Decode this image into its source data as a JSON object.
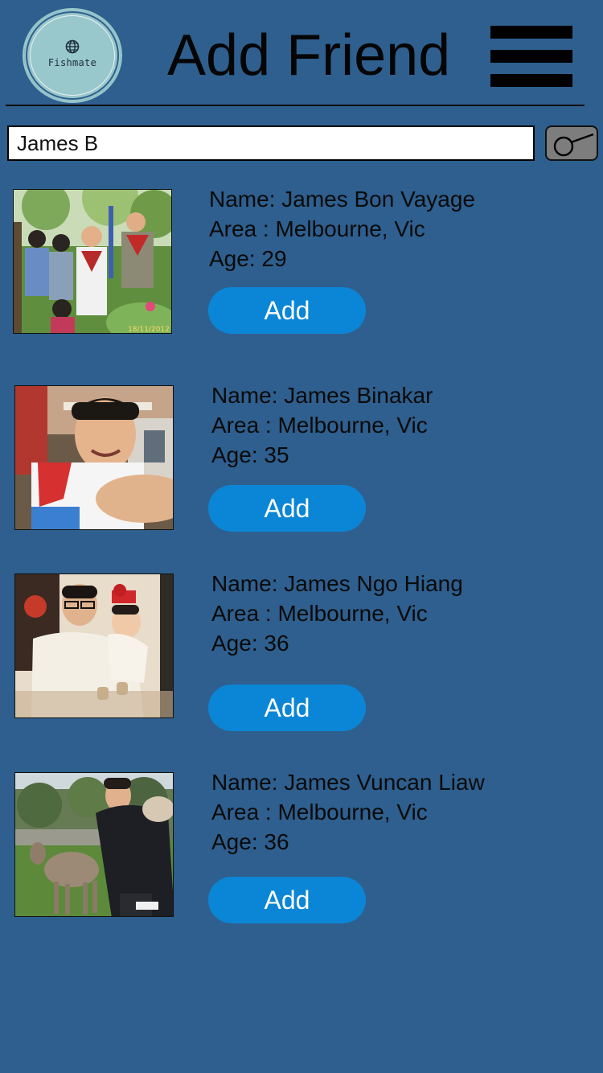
{
  "header": {
    "logo_text": "Fishmate",
    "title": "Add Friend"
  },
  "search": {
    "value": "James B"
  },
  "results": [
    {
      "name": "Name: James Bon Vayage",
      "area": "Area : Melbourne, Vic",
      "age": "Age: 29",
      "add_label": "Add",
      "photo_stamp": "18/11/2012"
    },
    {
      "name": "Name: James Binakar",
      "area": "Area : Melbourne, Vic",
      "age": "Age: 35",
      "add_label": "Add"
    },
    {
      "name": "Name: James Ngo Hiang",
      "area": "Area : Melbourne, Vic",
      "age": "Age: 36",
      "add_label": "Add"
    },
    {
      "name": "Name: James Vuncan Liaw",
      "area": "Area : Melbourne, Vic",
      "age": "Age: 36",
      "add_label": "Add"
    }
  ],
  "colors": {
    "background": "#2e5f8e",
    "add_button": "#0b86d6",
    "logo": "#98c7cc",
    "search_button": "#7d7d7d"
  },
  "icons": {
    "menu": "hamburger-menu-icon",
    "search": "search-icon",
    "logo": "globe-icon"
  }
}
